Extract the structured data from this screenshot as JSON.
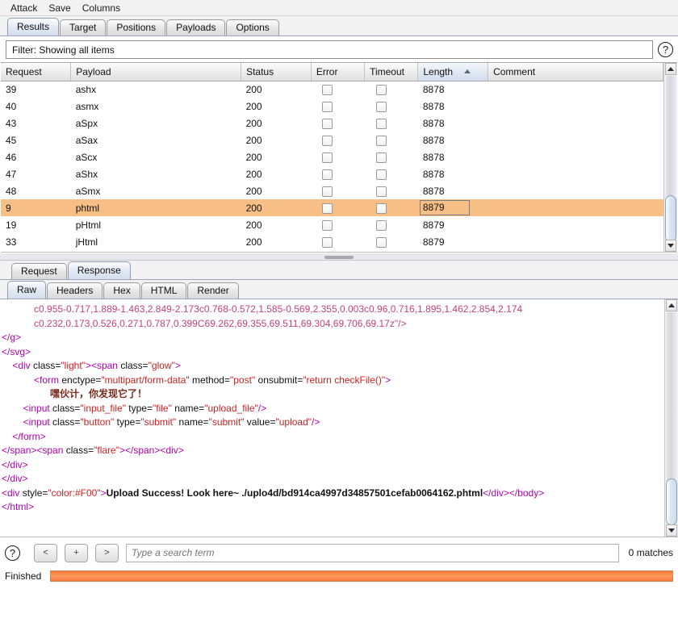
{
  "menu": {
    "items": [
      {
        "label": "Attack"
      },
      {
        "label": "Save"
      },
      {
        "label": "Columns"
      }
    ]
  },
  "tabs": {
    "items": [
      {
        "label": "Results",
        "active": true
      },
      {
        "label": "Target",
        "active": false
      },
      {
        "label": "Positions",
        "active": false
      },
      {
        "label": "Payloads",
        "active": false
      },
      {
        "label": "Options",
        "active": false
      }
    ]
  },
  "filter": {
    "text": "Filter: Showing all items",
    "help_icon": "help-circle-icon",
    "help_glyph": "?"
  },
  "results_table": {
    "columns": [
      {
        "label": "Request",
        "sorted": false
      },
      {
        "label": "Payload",
        "sorted": false
      },
      {
        "label": "Status",
        "sorted": false
      },
      {
        "label": "Error",
        "sorted": false
      },
      {
        "label": "Timeout",
        "sorted": false
      },
      {
        "label": "Length",
        "sorted": true,
        "sort_direction": "asc"
      },
      {
        "label": "Comment",
        "sorted": false
      }
    ],
    "rows": [
      {
        "request": "39",
        "payload": "ashx",
        "status": "200",
        "error": false,
        "timeout": false,
        "length": "8878",
        "comment": "",
        "selected": false
      },
      {
        "request": "40",
        "payload": "asmx",
        "status": "200",
        "error": false,
        "timeout": false,
        "length": "8878",
        "comment": "",
        "selected": false
      },
      {
        "request": "43",
        "payload": "aSpx",
        "status": "200",
        "error": false,
        "timeout": false,
        "length": "8878",
        "comment": "",
        "selected": false
      },
      {
        "request": "45",
        "payload": "aSax",
        "status": "200",
        "error": false,
        "timeout": false,
        "length": "8878",
        "comment": "",
        "selected": false
      },
      {
        "request": "46",
        "payload": "aScx",
        "status": "200",
        "error": false,
        "timeout": false,
        "length": "8878",
        "comment": "",
        "selected": false
      },
      {
        "request": "47",
        "payload": "aShx",
        "status": "200",
        "error": false,
        "timeout": false,
        "length": "8878",
        "comment": "",
        "selected": false
      },
      {
        "request": "48",
        "payload": "aSmx",
        "status": "200",
        "error": false,
        "timeout": false,
        "length": "8878",
        "comment": "",
        "selected": false
      },
      {
        "request": "9",
        "payload": "phtml",
        "status": "200",
        "error": false,
        "timeout": false,
        "length": "8879",
        "comment": "",
        "selected": true
      },
      {
        "request": "19",
        "payload": "pHtml",
        "status": "200",
        "error": false,
        "timeout": false,
        "length": "8879",
        "comment": "",
        "selected": false
      },
      {
        "request": "33",
        "payload": "jHtml",
        "status": "200",
        "error": false,
        "timeout": false,
        "length": "8879",
        "comment": "",
        "selected": false
      }
    ]
  },
  "message_tabs": {
    "items": [
      {
        "label": "Request",
        "active": false
      },
      {
        "label": "Response",
        "active": true
      }
    ]
  },
  "view_tabs": {
    "items": [
      {
        "label": "Raw",
        "active": true
      },
      {
        "label": "Headers",
        "active": false
      },
      {
        "label": "Hex",
        "active": false
      },
      {
        "label": "HTML",
        "active": false
      },
      {
        "label": "Render",
        "active": false
      }
    ]
  },
  "response": {
    "lines": [
      {
        "indent": 0,
        "segments": [
          {
            "class": "t-path",
            "text": "            c0.955-0.717,1.889-1.463,2.849-2.173c0.768-0.572,1.585-0.569,2.355,0.003c0.96,0.716,1.895,1.462,2.854,2.174"
          }
        ]
      },
      {
        "indent": 0,
        "segments": [
          {
            "class": "t-path",
            "text": "            c0.232,0.173,0.526,0.271,0.787,0.399C69.262,69.355,69.511,69.304,69.706,69.17z\"/>"
          }
        ]
      },
      {
        "indent": 0,
        "segments": [
          {
            "class": "t-tag",
            "text": "</g>"
          }
        ]
      },
      {
        "indent": 0,
        "segments": [
          {
            "class": "t-tag",
            "text": "</svg>"
          }
        ]
      },
      {
        "indent": 0,
        "segments": [
          {
            "class": "t-tag",
            "text": "    <div "
          },
          {
            "class": "t-attr",
            "text": "class="
          },
          {
            "class": "t-val",
            "text": "\"light\""
          },
          {
            "class": "t-tag",
            "text": "><span "
          },
          {
            "class": "t-attr",
            "text": "class="
          },
          {
            "class": "t-val",
            "text": "\"glow\""
          },
          {
            "class": "t-tag",
            "text": ">"
          }
        ]
      },
      {
        "indent": 0,
        "segments": [
          {
            "class": "t-tag",
            "text": "            <form "
          },
          {
            "class": "t-attr",
            "text": "enctype="
          },
          {
            "class": "t-val",
            "text": "\"multipart/form-data\""
          },
          {
            "class": "t-attr",
            "text": " method="
          },
          {
            "class": "t-val",
            "text": "\"post\""
          },
          {
            "class": "t-attr",
            "text": " onsubmit="
          },
          {
            "class": "t-val",
            "text": "\"return checkFile()\""
          },
          {
            "class": "t-tag",
            "text": ">"
          }
        ]
      },
      {
        "indent": 0,
        "segments": [
          {
            "class": "t-cn",
            "text": "                  嘿伙计，你发现它了！"
          }
        ]
      },
      {
        "indent": 0,
        "segments": [
          {
            "class": "t-tag",
            "text": "        <input "
          },
          {
            "class": "t-attr",
            "text": "class="
          },
          {
            "class": "t-val",
            "text": "\"input_file\""
          },
          {
            "class": "t-attr",
            "text": " type="
          },
          {
            "class": "t-val",
            "text": "\"file\""
          },
          {
            "class": "t-attr",
            "text": " name="
          },
          {
            "class": "t-val",
            "text": "\"upload_file\""
          },
          {
            "class": "t-tag",
            "text": "/>"
          }
        ]
      },
      {
        "indent": 0,
        "segments": [
          {
            "class": "t-tag",
            "text": "        <input "
          },
          {
            "class": "t-attr",
            "text": "class="
          },
          {
            "class": "t-val",
            "text": "\"button\""
          },
          {
            "class": "t-attr",
            "text": " type="
          },
          {
            "class": "t-val",
            "text": "\"submit\""
          },
          {
            "class": "t-attr",
            "text": " name="
          },
          {
            "class": "t-val",
            "text": "\"submit\""
          },
          {
            "class": "t-attr",
            "text": " value="
          },
          {
            "class": "t-val",
            "text": "\"upload\""
          },
          {
            "class": "t-tag",
            "text": "/>"
          }
        ]
      },
      {
        "indent": 0,
        "segments": [
          {
            "class": "t-tag",
            "text": "    </form>"
          }
        ]
      },
      {
        "indent": 0,
        "segments": [
          {
            "class": "t-tag",
            "text": "</span><span "
          },
          {
            "class": "t-attr",
            "text": "class="
          },
          {
            "class": "t-val",
            "text": "\"flare\""
          },
          {
            "class": "t-tag",
            "text": "></span><div>"
          }
        ]
      },
      {
        "indent": 0,
        "segments": [
          {
            "class": "t-tag",
            "text": "</div>"
          }
        ]
      },
      {
        "indent": 0,
        "segments": [
          {
            "class": "t-tag",
            "text": "</div>"
          }
        ]
      },
      {
        "indent": 0,
        "segments": [
          {
            "class": "t-tag",
            "text": "<div "
          },
          {
            "class": "t-attr",
            "text": "style="
          },
          {
            "class": "t-val",
            "text": "\"color:#F00\""
          },
          {
            "class": "t-tag",
            "text": ">"
          },
          {
            "class": "t-succ",
            "text": "Upload Success! Look here~ ./uplo4d/bd914ca4997d34857501cefab0064162.phtml"
          },
          {
            "class": "t-tag",
            "text": "</div></body>"
          }
        ]
      },
      {
        "indent": 0,
        "segments": [
          {
            "class": "t-tag",
            "text": "</html>"
          }
        ]
      }
    ]
  },
  "search": {
    "help_icon": "help-circle-icon",
    "help_glyph": "?",
    "prev_label": "<",
    "add_label": "+",
    "next_label": ">",
    "placeholder": "Type a search term",
    "value": "",
    "matches_label": "0 matches"
  },
  "status": {
    "label": "Finished",
    "progress_percent": 100,
    "progress_color": "#f4803c"
  }
}
